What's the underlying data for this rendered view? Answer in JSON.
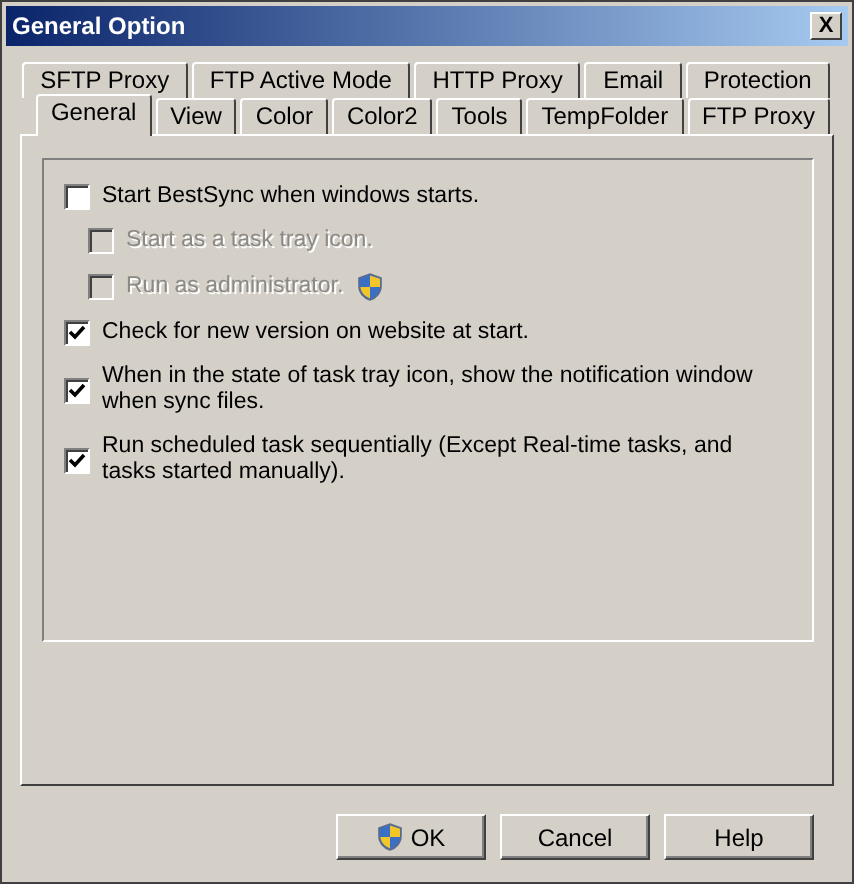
{
  "window": {
    "title": "General Option",
    "close": "X"
  },
  "tab_rows": [
    [
      {
        "label": "SFTP Proxy",
        "selected": false
      },
      {
        "label": "FTP Active Mode",
        "selected": false
      },
      {
        "label": "HTTP Proxy",
        "selected": false
      },
      {
        "label": "Email",
        "selected": false
      },
      {
        "label": "Protection",
        "selected": false
      }
    ],
    [
      {
        "label": "General",
        "selected": true
      },
      {
        "label": "View",
        "selected": false
      },
      {
        "label": "Color",
        "selected": false
      },
      {
        "label": "Color2",
        "selected": false
      },
      {
        "label": "Tools",
        "selected": false
      },
      {
        "label": "TempFolder",
        "selected": false
      },
      {
        "label": "FTP Proxy",
        "selected": false
      }
    ]
  ],
  "options": [
    {
      "kind": "checkbox",
      "label": "Start BestSync when windows starts.",
      "checked": false,
      "disabled": false,
      "children": [
        {
          "kind": "checkbox",
          "label": "Start as a task tray icon.",
          "checked": false,
          "disabled": true
        },
        {
          "kind": "elevated",
          "label": "Run as administrator.",
          "checked": false,
          "disabled": true
        }
      ]
    },
    {
      "kind": "checkbox",
      "label": "Check for new version on website at start.",
      "checked": true,
      "disabled": false
    },
    {
      "kind": "checkbox",
      "label": "When in the state of task tray icon, show the notification window when sync files.",
      "checked": true,
      "disabled": false
    },
    {
      "kind": "checkbox",
      "label": "Run scheduled task sequentially (Except Real-time tasks, and tasks started manually).",
      "checked": true,
      "disabled": false
    }
  ],
  "buttons": [
    {
      "kind": "elevated",
      "label": "OK"
    },
    {
      "kind": "plain",
      "label": "Cancel"
    },
    {
      "kind": "plain",
      "label": "Help"
    }
  ]
}
